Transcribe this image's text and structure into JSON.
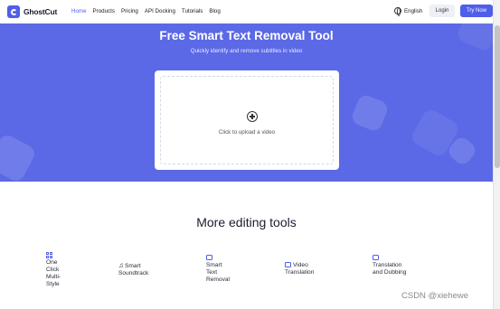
{
  "brand": {
    "name": "GhostCut",
    "accent": "#4f5ee8",
    "hero_bg": "#5b69e6"
  },
  "nav": {
    "items": [
      {
        "label": "Home",
        "active": true
      },
      {
        "label": "Products",
        "active": false
      },
      {
        "label": "Pricing",
        "active": false
      },
      {
        "label": "API Docking",
        "active": false
      },
      {
        "label": "Tutorials",
        "active": false
      },
      {
        "label": "Blog",
        "active": false
      }
    ],
    "language": "English",
    "login": "Login",
    "try_now": "Try Now"
  },
  "hero": {
    "title": "Free Smart Text Removal Tool",
    "subtitle": "Quickly identify and remove subtitles in video",
    "upload_text": "Click to upload a video"
  },
  "tools": {
    "title": "More editing tools",
    "items": [
      {
        "label": "One Click Multi-Style",
        "icon": "grid-icon"
      },
      {
        "label": "Smart Soundtrack",
        "icon": "music-note-icon"
      },
      {
        "label": "Smart Text Removal",
        "icon": "video-icon"
      },
      {
        "label": "Video Translation",
        "icon": "video-icon"
      },
      {
        "label": "Translation and Dubbing",
        "icon": "video-icon"
      }
    ]
  },
  "watermark": "CSDN @xiehewe"
}
